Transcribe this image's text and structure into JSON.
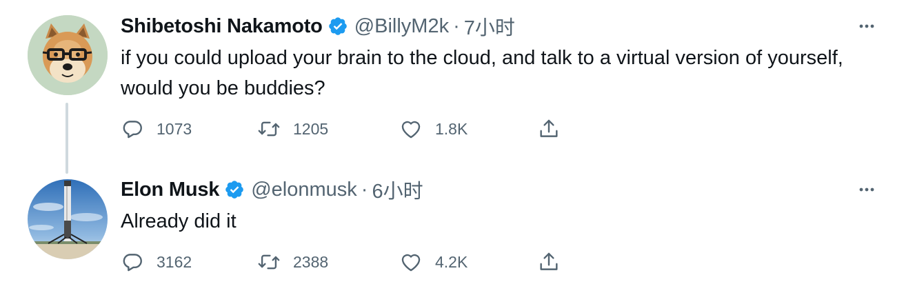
{
  "colors": {
    "verified_badge": "#1d9bf0",
    "secondary_text": "#536471",
    "primary_text": "#0f1419",
    "thread_line": "#cfd9de"
  },
  "tweets": [
    {
      "display_name": "Shibetoshi Nakamoto",
      "handle": "@BillyM2k",
      "separator": "·",
      "time": "7小时",
      "text": "if you could upload your brain to the cloud, and talk to a virtual version of yourself, would you be buddies?",
      "avatar_icon": "doge-glasses-avatar",
      "reply_count": "1073",
      "retweet_count": "1205",
      "like_count": "1.8K"
    },
    {
      "display_name": "Elon Musk",
      "handle": "@elonmusk",
      "separator": "·",
      "time": "6小时",
      "text": "Already did it",
      "avatar_icon": "rocket-launchpad-avatar",
      "reply_count": "3162",
      "retweet_count": "2388",
      "like_count": "4.2K"
    }
  ]
}
